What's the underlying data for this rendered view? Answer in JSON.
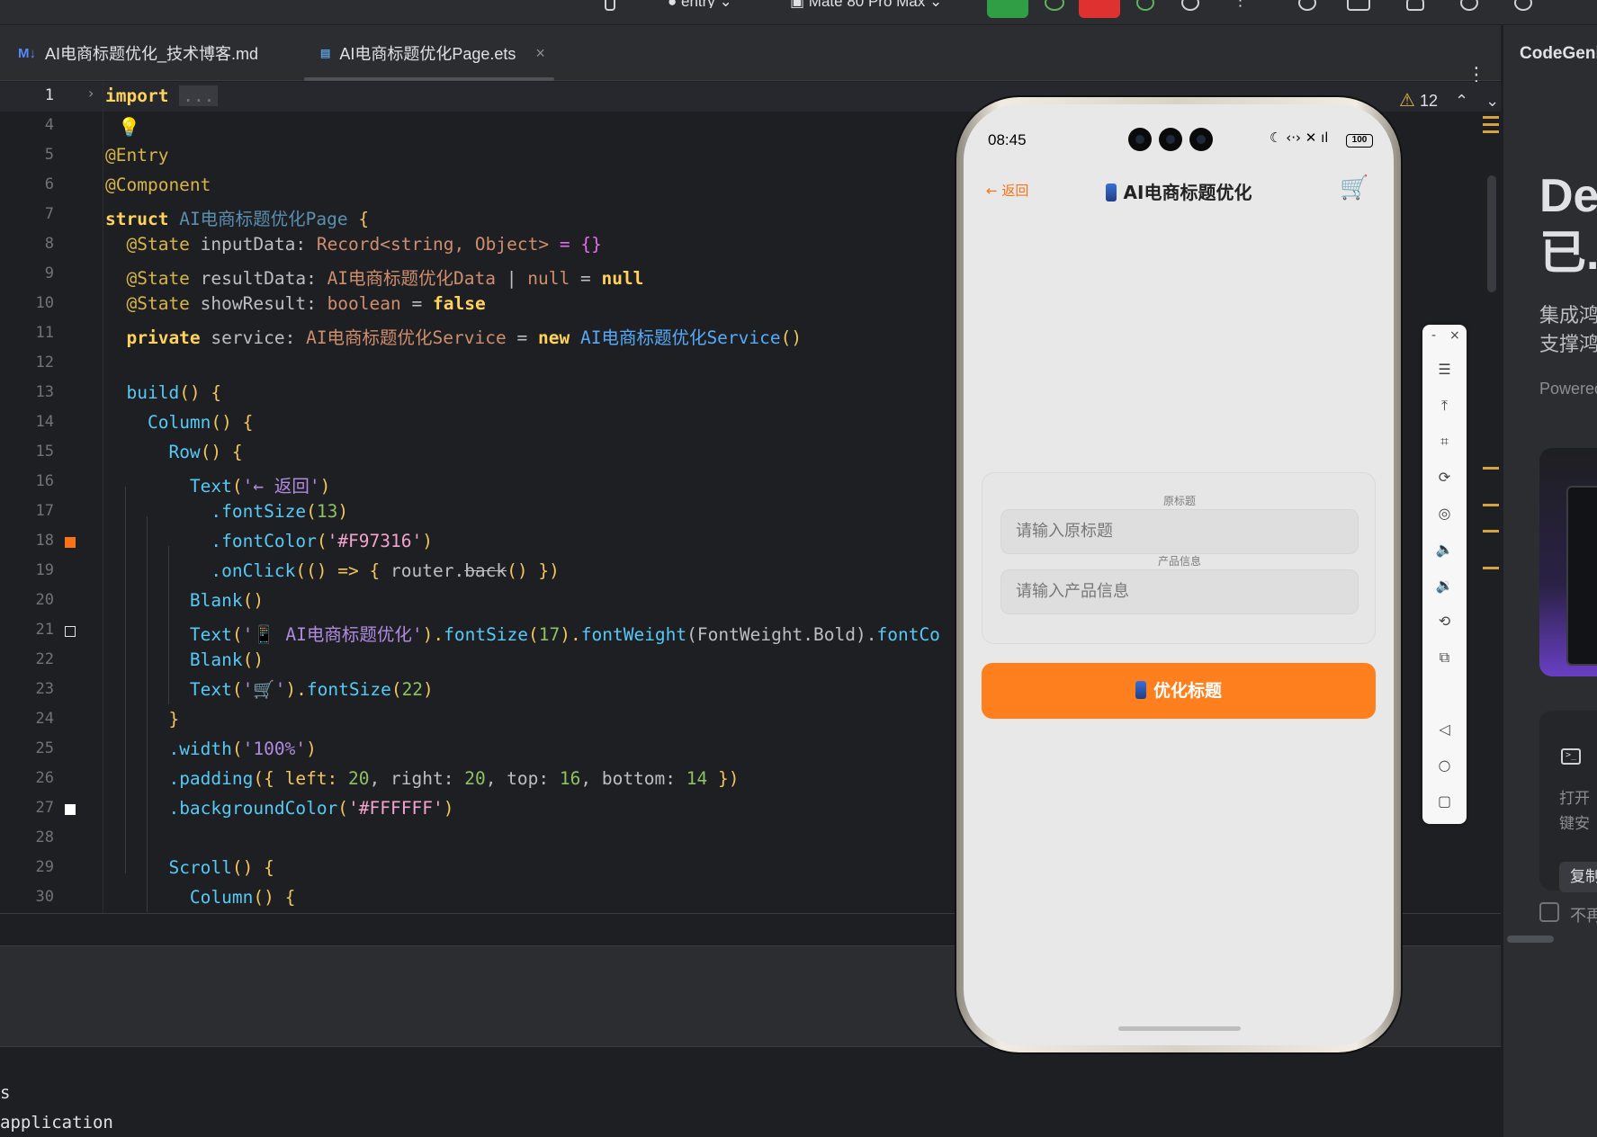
{
  "toolbar": {
    "module": "entry",
    "device": "Mate 80 Pro Max",
    "colors": {
      "run": "#2f9e44",
      "stop": "#e03131",
      "accent": "#f97316"
    }
  },
  "tabs": [
    {
      "icon": "M↓",
      "label": "AI电商标题优化_技术博客.md",
      "active": false
    },
    {
      "icon": "ets",
      "label": "AI电商标题优化Page.ets",
      "active": true,
      "close": "×"
    }
  ],
  "editor": {
    "warning_count": "12",
    "line_numbers": [
      "1",
      "4",
      "5",
      "6",
      "7",
      "8",
      "9",
      "10",
      "11",
      "12",
      "13",
      "14",
      "15",
      "16",
      "17",
      "18",
      "19",
      "20",
      "21",
      "22",
      "23",
      "24",
      "25",
      "26",
      "27",
      "28",
      "29",
      "30"
    ],
    "lines": {
      "l1_kw": "import",
      "l1_fold": "...",
      "l5": "@Entry",
      "l6": "@Component",
      "l7_kw": "struct",
      "l7_name": "AI电商标题优化Page",
      "l7_brace": " {",
      "l8_ann": "@State",
      "l8_name": " inputData: ",
      "l8_type": "Record<string, Object>",
      "l8_rest": " = {}",
      "l9_ann": "@State",
      "l9_name": " resultData: ",
      "l9_type": "AI电商标题优化Data",
      "l9_mid": " | ",
      "l9_null1": "null",
      "l9_eq": " = ",
      "l9_null2": "null",
      "l10_ann": "@State",
      "l10_name": " showResult: ",
      "l10_type": "boolean",
      "l10_eq": " = ",
      "l10_val": "false",
      "l11_kw": "private",
      "l11_name": " service: ",
      "l11_type": "AI电商标题优化Service",
      "l11_eq": " = ",
      "l11_new": "new",
      "l11_cls": " AI电商标题优化Service",
      "l11_paren": "()",
      "l13_fn": "build",
      "l13_rest": "() {",
      "l14_fn": "Column",
      "l14_rest": "() {",
      "l15_fn": "Row",
      "l15_rest": "() {",
      "l16_fn": "Text",
      "l16_open": "(",
      "l16_str": "'← 返回'",
      "l16_close": ")",
      "l17_m": ".fontSize",
      "l17_open": "(",
      "l17_n": "13",
      "l17_close": ")",
      "l18_m": ".fontColor",
      "l18_open": "(",
      "l18_str": "'#F97316'",
      "l18_close": ")",
      "l19_m": ".onClick",
      "l19_a": "(() => { ",
      "l19_b": "router.",
      "l19_c": "back",
      "l19_d": "() })",
      "l20_fn": "Blank",
      "l20_rest": "()",
      "l21_fn": "Text",
      "l21_open": "(",
      "l21_str": "'📱 AI电商标题优化'",
      "l21_c1": ").",
      "l21_m1": "fontSize",
      "l21_open2": "(",
      "l21_n": "17",
      "l21_c2": ").",
      "l21_m2": "fontWeight",
      "l21_arg": "(FontWeight.Bold).",
      "l21_m3": "fontCo",
      "l22_fn": "Blank",
      "l22_rest": "()",
      "l23_fn": "Text",
      "l23_open": "(",
      "l23_str": "'🛒'",
      "l23_c": ").",
      "l23_m": "fontSize",
      "l23_open2": "(",
      "l23_n": "22",
      "l23_close": ")",
      "l24": "}",
      "l25_m": ".width",
      "l25_open": "(",
      "l25_str": "'100%'",
      "l25_close": ")",
      "l26_m": ".padding",
      "l26_a": "({ left: ",
      "l26_n1": "20",
      "l26_b": ", right: ",
      "l26_n2": "20",
      "l26_c": ", top: ",
      "l26_n3": "16",
      "l26_d": ", bottom: ",
      "l26_n4": "14",
      "l26_e": " })",
      "l27_m": ".backgroundColor",
      "l27_open": "(",
      "l27_str": "'#FFFFFF'",
      "l27_close": ")",
      "l29_fn": "Scroll",
      "l29_rest": "() {",
      "l30_fn": "Column",
      "l30_rest": "() {"
    },
    "gutter_colors": {
      "l18": "#F97316",
      "l21": "#1e1f22",
      "l27": "#FFFFFF"
    }
  },
  "terminal": {
    "line1": "s",
    "line2": "application"
  },
  "right_panel": {
    "title": "CodeGeni",
    "big_1": "De",
    "big_2": "已.",
    "desc_1": "集成鸿",
    "desc_2": "支撑鸿",
    "powered": "Powerec",
    "card_text_1": "打开",
    "card_text_2": "键安",
    "copy_label": "复制",
    "checkbox_label": "不再"
  },
  "phone": {
    "time": "08:45",
    "battery": "100",
    "back": "← 返回",
    "title": "AI电商标题优化",
    "cart_icon": "🛒",
    "field1_label": "原标题",
    "field1_placeholder": "请输入原标题",
    "field2_label": "产品信息",
    "field2_placeholder": "请输入产品信息",
    "button": "优化标题"
  },
  "emulator_tools": {
    "minimize": "-",
    "close": "×",
    "icons": [
      "menu-icon",
      "top-icon",
      "crop-icon",
      "rotate-icon",
      "screenshot-icon",
      "volume-up-icon",
      "volume-down-icon",
      "fold-icon",
      "multi-screen-icon",
      "back-nav-icon",
      "home-nav-icon",
      "recent-nav-icon"
    ]
  }
}
